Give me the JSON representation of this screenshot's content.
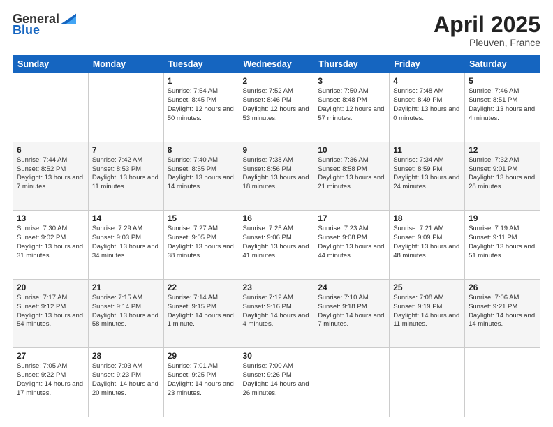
{
  "header": {
    "logo_general": "General",
    "logo_blue": "Blue",
    "title": "April 2025",
    "location": "Pleuven, France"
  },
  "days_of_week": [
    "Sunday",
    "Monday",
    "Tuesday",
    "Wednesday",
    "Thursday",
    "Friday",
    "Saturday"
  ],
  "weeks": [
    [
      {
        "day": "",
        "info": ""
      },
      {
        "day": "",
        "info": ""
      },
      {
        "day": "1",
        "info": "Sunrise: 7:54 AM\nSunset: 8:45 PM\nDaylight: 12 hours and 50 minutes."
      },
      {
        "day": "2",
        "info": "Sunrise: 7:52 AM\nSunset: 8:46 PM\nDaylight: 12 hours and 53 minutes."
      },
      {
        "day": "3",
        "info": "Sunrise: 7:50 AM\nSunset: 8:48 PM\nDaylight: 12 hours and 57 minutes."
      },
      {
        "day": "4",
        "info": "Sunrise: 7:48 AM\nSunset: 8:49 PM\nDaylight: 13 hours and 0 minutes."
      },
      {
        "day": "5",
        "info": "Sunrise: 7:46 AM\nSunset: 8:51 PM\nDaylight: 13 hours and 4 minutes."
      }
    ],
    [
      {
        "day": "6",
        "info": "Sunrise: 7:44 AM\nSunset: 8:52 PM\nDaylight: 13 hours and 7 minutes."
      },
      {
        "day": "7",
        "info": "Sunrise: 7:42 AM\nSunset: 8:53 PM\nDaylight: 13 hours and 11 minutes."
      },
      {
        "day": "8",
        "info": "Sunrise: 7:40 AM\nSunset: 8:55 PM\nDaylight: 13 hours and 14 minutes."
      },
      {
        "day": "9",
        "info": "Sunrise: 7:38 AM\nSunset: 8:56 PM\nDaylight: 13 hours and 18 minutes."
      },
      {
        "day": "10",
        "info": "Sunrise: 7:36 AM\nSunset: 8:58 PM\nDaylight: 13 hours and 21 minutes."
      },
      {
        "day": "11",
        "info": "Sunrise: 7:34 AM\nSunset: 8:59 PM\nDaylight: 13 hours and 24 minutes."
      },
      {
        "day": "12",
        "info": "Sunrise: 7:32 AM\nSunset: 9:01 PM\nDaylight: 13 hours and 28 minutes."
      }
    ],
    [
      {
        "day": "13",
        "info": "Sunrise: 7:30 AM\nSunset: 9:02 PM\nDaylight: 13 hours and 31 minutes."
      },
      {
        "day": "14",
        "info": "Sunrise: 7:29 AM\nSunset: 9:03 PM\nDaylight: 13 hours and 34 minutes."
      },
      {
        "day": "15",
        "info": "Sunrise: 7:27 AM\nSunset: 9:05 PM\nDaylight: 13 hours and 38 minutes."
      },
      {
        "day": "16",
        "info": "Sunrise: 7:25 AM\nSunset: 9:06 PM\nDaylight: 13 hours and 41 minutes."
      },
      {
        "day": "17",
        "info": "Sunrise: 7:23 AM\nSunset: 9:08 PM\nDaylight: 13 hours and 44 minutes."
      },
      {
        "day": "18",
        "info": "Sunrise: 7:21 AM\nSunset: 9:09 PM\nDaylight: 13 hours and 48 minutes."
      },
      {
        "day": "19",
        "info": "Sunrise: 7:19 AM\nSunset: 9:11 PM\nDaylight: 13 hours and 51 minutes."
      }
    ],
    [
      {
        "day": "20",
        "info": "Sunrise: 7:17 AM\nSunset: 9:12 PM\nDaylight: 13 hours and 54 minutes."
      },
      {
        "day": "21",
        "info": "Sunrise: 7:15 AM\nSunset: 9:14 PM\nDaylight: 13 hours and 58 minutes."
      },
      {
        "day": "22",
        "info": "Sunrise: 7:14 AM\nSunset: 9:15 PM\nDaylight: 14 hours and 1 minute."
      },
      {
        "day": "23",
        "info": "Sunrise: 7:12 AM\nSunset: 9:16 PM\nDaylight: 14 hours and 4 minutes."
      },
      {
        "day": "24",
        "info": "Sunrise: 7:10 AM\nSunset: 9:18 PM\nDaylight: 14 hours and 7 minutes."
      },
      {
        "day": "25",
        "info": "Sunrise: 7:08 AM\nSunset: 9:19 PM\nDaylight: 14 hours and 11 minutes."
      },
      {
        "day": "26",
        "info": "Sunrise: 7:06 AM\nSunset: 9:21 PM\nDaylight: 14 hours and 14 minutes."
      }
    ],
    [
      {
        "day": "27",
        "info": "Sunrise: 7:05 AM\nSunset: 9:22 PM\nDaylight: 14 hours and 17 minutes."
      },
      {
        "day": "28",
        "info": "Sunrise: 7:03 AM\nSunset: 9:23 PM\nDaylight: 14 hours and 20 minutes."
      },
      {
        "day": "29",
        "info": "Sunrise: 7:01 AM\nSunset: 9:25 PM\nDaylight: 14 hours and 23 minutes."
      },
      {
        "day": "30",
        "info": "Sunrise: 7:00 AM\nSunset: 9:26 PM\nDaylight: 14 hours and 26 minutes."
      },
      {
        "day": "",
        "info": ""
      },
      {
        "day": "",
        "info": ""
      },
      {
        "day": "",
        "info": ""
      }
    ]
  ]
}
